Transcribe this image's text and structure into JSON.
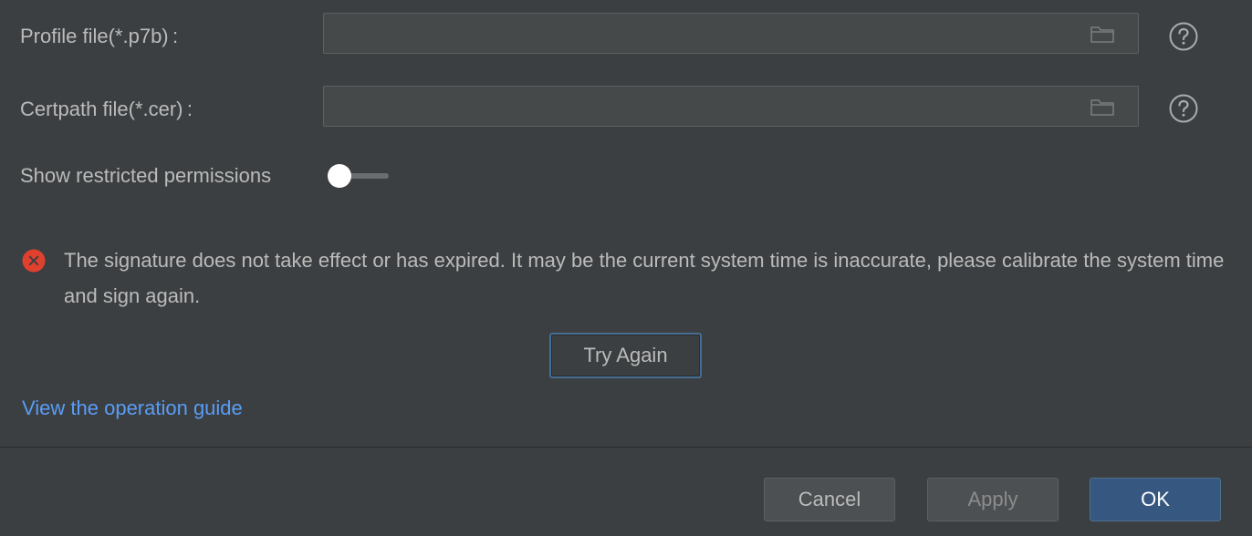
{
  "form": {
    "profile_label": "Profile file(*.p7b) :",
    "profile_value": "",
    "certpath_label": "Certpath file(*.cer) :",
    "certpath_value": "",
    "restricted_label": "Show restricted permissions",
    "restricted_enabled": false
  },
  "error": {
    "icon": "error-circle-x-icon",
    "message": "The signature does not take effect or has expired. It may be the current system time is inaccurate, please calibrate the system time and sign again.",
    "retry_label": "Try Again"
  },
  "guide": {
    "link_text": "View the operation guide"
  },
  "footer": {
    "cancel_label": "Cancel",
    "apply_label": "Apply",
    "ok_label": "OK"
  },
  "colors": {
    "background": "#3c3f41",
    "text": "#bbbbbb",
    "link": "#589df6",
    "error": "#e0412e",
    "primary_button": "#365880",
    "focus_border": "#466d94"
  }
}
